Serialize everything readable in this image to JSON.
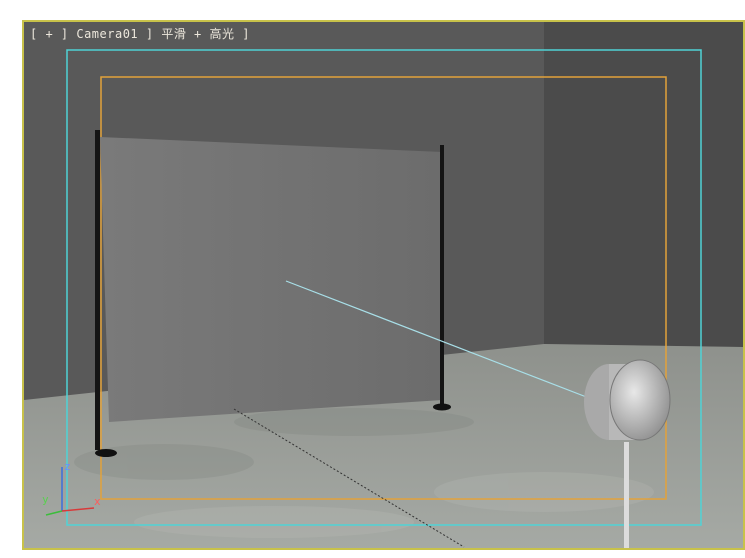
{
  "viewport": {
    "label": "[ + ] Camera01 ] 平滑 + 高光 ]",
    "menu": {
      "plus": "+",
      "camera": "Camera01",
      "shading": "平滑 + 高光"
    },
    "safe_frame_color": "#4fd3d6",
    "render_frame_color": "#e3a23a",
    "border_color": "#c8c24a",
    "axis_labels": {
      "x": "x",
      "y": "y",
      "z": "z"
    }
  },
  "scene": {
    "objects": [
      "back-wall",
      "side-wall",
      "floor",
      "screen-panel",
      "left-pole",
      "right-pole",
      "spotlight",
      "target-line"
    ]
  }
}
